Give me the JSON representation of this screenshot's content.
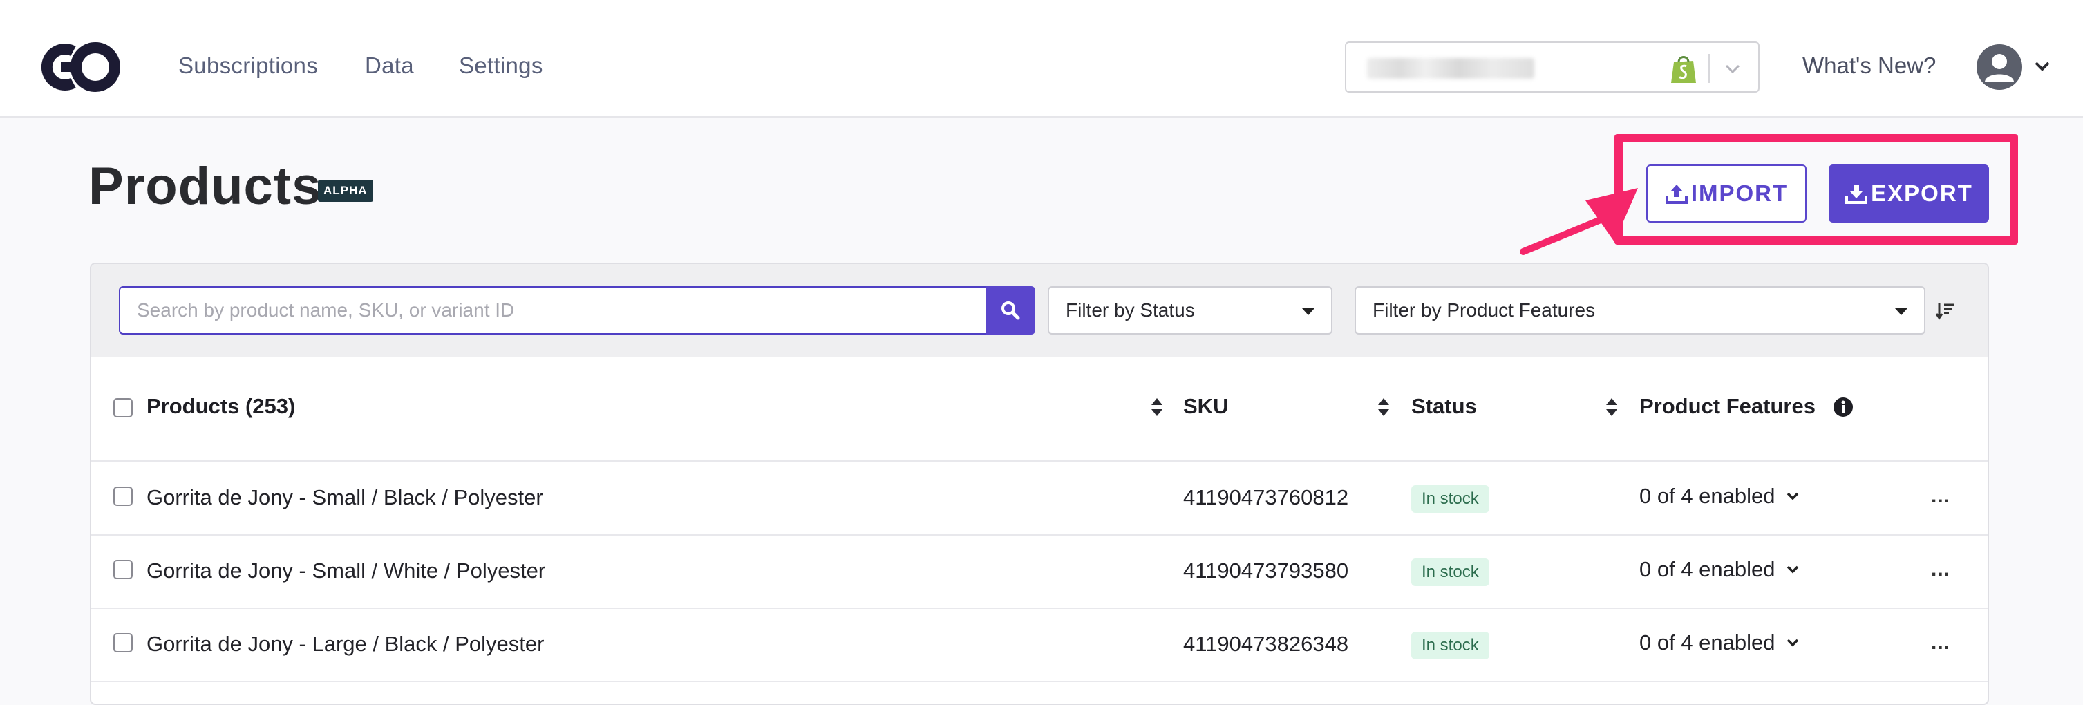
{
  "nav": {
    "links": [
      "Subscriptions",
      "Data",
      "Settings"
    ],
    "whats_new": "What's New?",
    "store_icon": "shopify-bag-icon"
  },
  "page": {
    "title": "Products",
    "badge": "ALPHA"
  },
  "actions": {
    "import_label": "IMPORT",
    "export_label": "EXPORT",
    "highlight_color": "#f5266a",
    "accent_color": "#5a46cc"
  },
  "filters": {
    "search_placeholder": "Search by product name, SKU, or variant ID",
    "status_label": "Filter by Status",
    "features_label": "Filter by Product Features"
  },
  "table": {
    "headers": {
      "products": "Products (253)",
      "sku": "SKU",
      "status": "Status",
      "features": "Product Features"
    },
    "rows": [
      {
        "name": "Gorrita de Jony - Small / Black / Polyester",
        "sku": "41190473760812",
        "status": "In stock",
        "features": "0 of 4 enabled"
      },
      {
        "name": "Gorrita de Jony - Small / White / Polyester",
        "sku": "41190473793580",
        "status": "In stock",
        "features": "0 of 4 enabled"
      },
      {
        "name": "Gorrita de Jony - Large / Black / Polyester",
        "sku": "41190473826348",
        "status": "In stock",
        "features": "0 of 4 enabled"
      }
    ],
    "more_label": "..."
  }
}
